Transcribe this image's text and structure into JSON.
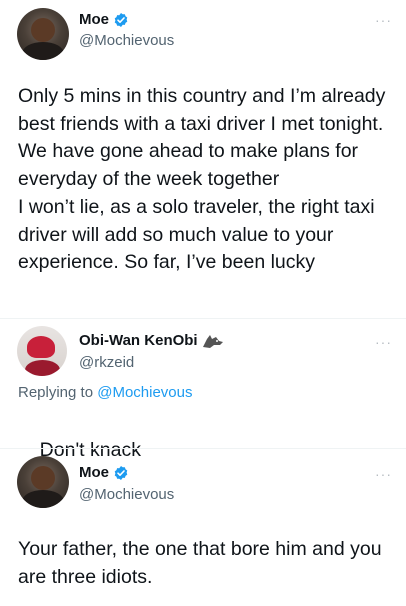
{
  "tweets": [
    {
      "name": "Moe",
      "handle": "@Mochievous",
      "verified": true,
      "text": "Only 5 mins in this country and I’m already best friends with a taxi driver I met tonight. We have gone ahead to make plans for everyday of the week together\nI won’t lie, as a solo traveler, the right taxi driver will add so much value to your experience. So far, I’ve been lucky",
      "more": "···"
    },
    {
      "name": "Obi-Wan KenObi",
      "handle": "@rkzeid",
      "verified": false,
      "replying_prefix": "Replying to",
      "replying_mention": "@Mochievous",
      "text": "Don't knack",
      "emoji": "smirk-emoji",
      "more": "···"
    },
    {
      "name": "Moe",
      "handle": "@Mochievous",
      "verified": true,
      "text": "Your father, the one that bore him and you are three idiots.",
      "more": "···"
    }
  ],
  "colors": {
    "verified": "#1d9bf0",
    "mention": "#1d9bf0",
    "secondary_text": "#536471",
    "primary_text": "#0f1419"
  }
}
